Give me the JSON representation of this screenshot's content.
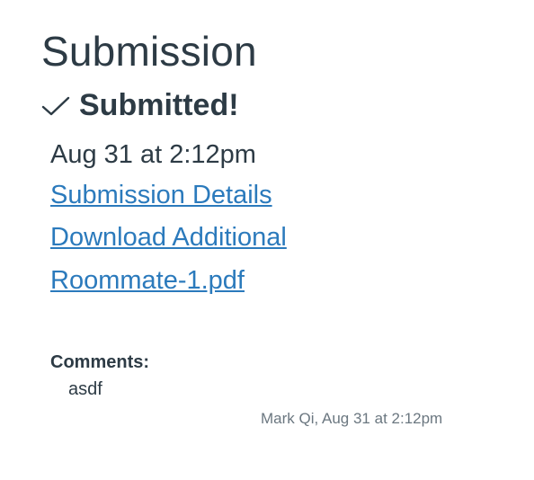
{
  "page": {
    "title": "Submission"
  },
  "status": {
    "icon": "checkmark-icon",
    "label": "Submitted!"
  },
  "submission": {
    "date": "Aug 31 at 2:12pm",
    "details_link": "Submission Details",
    "download_link": "Download Additional",
    "file_link": "Roommate-1.pdf"
  },
  "comments": {
    "label": "Comments:",
    "items": [
      {
        "text": "asdf",
        "meta": "Mark Qi, Aug 31 at 2:12pm"
      }
    ]
  },
  "colors": {
    "text": "#2d3b45",
    "link": "#2b7abc",
    "muted": "#6b7780"
  }
}
